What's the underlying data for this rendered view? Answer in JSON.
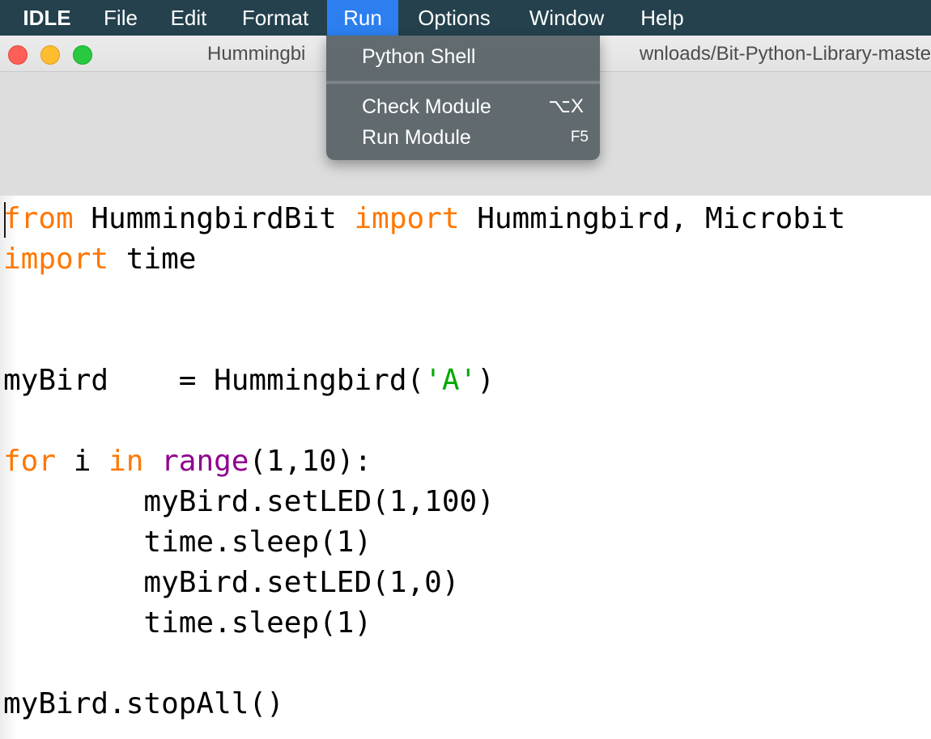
{
  "menubar": {
    "app_name": "IDLE",
    "items": [
      "File",
      "Edit",
      "Format",
      "Run",
      "Options",
      "Window",
      "Help"
    ],
    "active_item": "Run",
    "active_color": "#2d7ff0",
    "background_color": "#24414d"
  },
  "window": {
    "title_start": "Hummingbi",
    "title_end": "wnloads/Bit-Python-Library-maste",
    "buttons": [
      "close-icon",
      "minimize-icon",
      "zoom-icon"
    ]
  },
  "run_menu": {
    "items": [
      {
        "label": "Python Shell",
        "shortcut": ""
      },
      {
        "label": "Check Module",
        "shortcut": "⌥X"
      },
      {
        "label": "Run Module",
        "shortcut": "F5"
      }
    ]
  },
  "editor": {
    "colors": {
      "keyword": "#ff7700",
      "builtin": "#900090",
      "string": "#00aa00"
    },
    "lines": [
      "from HummingbirdBit import Hummingbird, Microbit",
      "import time",
      "",
      "",
      "myBird    = Hummingbird('A')",
      "",
      "for i in range(1,10):",
      "        myBird.setLED(1,100)",
      "        time.sleep(1)",
      "        myBird.setLED(1,0)",
      "        time.sleep(1)",
      "",
      "myBird.stopAll()"
    ],
    "tokens": {
      "l1": {
        "kw1": "from",
        "t1": " HummingbirdBit ",
        "kw2": "import",
        "t2": " Hummingbird, Microbit"
      },
      "l2": {
        "kw1": "import",
        "t1": " time"
      },
      "l5": {
        "t1": "myBird    = Hummingbird(",
        "str": "'A'",
        "t2": ")"
      },
      "l7": {
        "kw1": "for",
        "t1": " i ",
        "kw2": "in",
        "t2": " ",
        "builtin": "range",
        "t3": "(1,10):"
      },
      "l8": {
        "t1": "        myBird.setLED(1,100)"
      },
      "l9": {
        "t1": "        time.sleep(1)"
      },
      "l10": {
        "t1": "        myBird.setLED(1,0)"
      },
      "l11": {
        "t1": "        time.sleep(1)"
      },
      "l13": {
        "t1": "myBird.stopAll()"
      }
    }
  }
}
